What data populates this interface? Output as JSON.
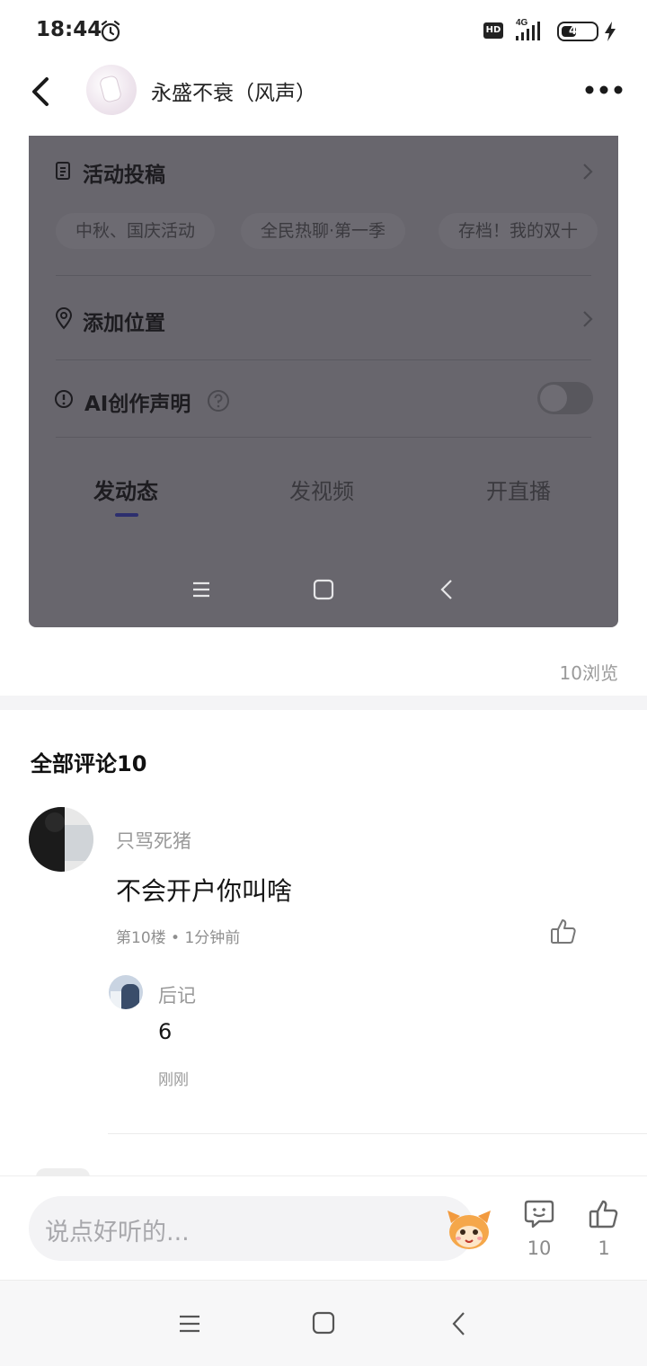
{
  "status_bar": {
    "time": "18:44",
    "hd": "HD",
    "network": "4G",
    "battery": "45",
    "battery_level_percent": 45,
    "icons": [
      "alarm-icon",
      "signal-icon",
      "battery-icon",
      "charging-bolt-icon"
    ]
  },
  "header": {
    "title": "永盛不衰（风声）",
    "icons": [
      "back-arrow-icon",
      "avatar",
      "more-dots-icon"
    ]
  },
  "embedded_screenshot": {
    "activity_label": "活动投稿",
    "tags": [
      "中秋、国庆活动",
      "全民热聊·第一季",
      "存档！我的双十"
    ],
    "location_label": "添加位置",
    "ai_label": "AI创作声明",
    "ai_toggle": false,
    "tabs": [
      "发动态",
      "发视频",
      "开直播"
    ],
    "active_tab": "发动态",
    "icons": [
      "document-icon",
      "location-pin-icon",
      "info-icon",
      "help-icon",
      "chevron-right-icon",
      "menu-icon",
      "home-square-icon",
      "back-chevron-icon"
    ]
  },
  "views": "10浏览",
  "comments": {
    "title": "全部评论10",
    "items": [
      {
        "user": "只骂死猪",
        "text": "不会开户你叫啥",
        "meta": "第10楼 • 1分钟前",
        "reply": {
          "user": "后记",
          "text": "6",
          "time": "刚刚"
        }
      }
    ]
  },
  "bottom_bar": {
    "input_placeholder": "说点好听的...",
    "comment_count": "10",
    "like_count": "1",
    "icons": [
      "emoji-mascot-icon",
      "comment-bubble-icon",
      "thumbs-up-icon"
    ]
  },
  "system_nav": {
    "icons": [
      "menu-icon",
      "home-square-icon",
      "back-chevron-icon"
    ]
  },
  "colors": {
    "overlay": "#68666d",
    "accent_underline": "#2d2f6e",
    "muted_text": "#999999"
  }
}
